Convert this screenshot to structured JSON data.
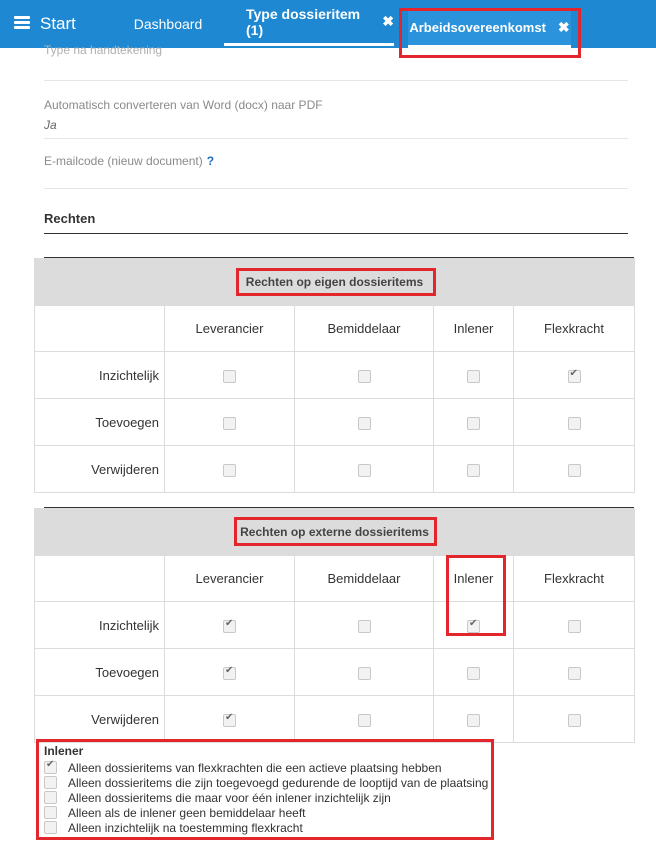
{
  "topbar": {
    "start_label": "Start",
    "tabs": [
      {
        "label": "Dashboard"
      },
      {
        "label": "Type dossieritem (1)",
        "close": "✖"
      },
      {
        "label": "Arbeidsovereenkomst",
        "close": "✖"
      }
    ]
  },
  "fields": {
    "handtekening_label": "Type na handtekening",
    "convert_label": "Automatisch converteren van Word (docx) naar PDF",
    "convert_value": "Ja",
    "email_label": "E-mailcode (nieuw document)",
    "email_help": "?"
  },
  "section": {
    "title": "Rechten"
  },
  "tables": [
    {
      "caption": "Rechten op eigen dossieritems",
      "columns": [
        "Leverancier",
        "Bemiddelaar",
        "Inlener",
        "Flexkracht"
      ],
      "rows": [
        {
          "label": "Inzichtelijk",
          "checked": [
            false,
            false,
            false,
            true
          ]
        },
        {
          "label": "Toevoegen",
          "checked": [
            false,
            false,
            false,
            false
          ]
        },
        {
          "label": "Verwijderen",
          "checked": [
            false,
            false,
            false,
            false
          ]
        }
      ]
    },
    {
      "caption": "Rechten op externe dossieritems",
      "columns": [
        "Leverancier",
        "Bemiddelaar",
        "Inlener",
        "Flexkracht"
      ],
      "rows": [
        {
          "label": "Inzichtelijk",
          "checked": [
            true,
            false,
            true,
            false
          ]
        },
        {
          "label": "Toevoegen",
          "checked": [
            true,
            false,
            false,
            false
          ]
        },
        {
          "label": "Verwijderen",
          "checked": [
            true,
            false,
            false,
            false
          ]
        }
      ]
    }
  ],
  "inlener": {
    "title": "Inlener",
    "options": [
      {
        "label": "Alleen dossieritems van flexkrachten die een actieve plaatsing hebben",
        "checked": true
      },
      {
        "label": "Alleen dossieritems die zijn toegevoegd gedurende de looptijd van de plaatsing",
        "checked": false
      },
      {
        "label": "Alleen dossieritems die maar voor één inlener inzichtelijk zijn",
        "checked": false
      },
      {
        "label": "Alleen als de inlener geen bemiddelaar heeft",
        "checked": false
      },
      {
        "label": "Alleen inzichtelijk na toestemming flexkracht",
        "checked": false
      }
    ]
  },
  "colors": {
    "topbar": "#1e88d2",
    "highlight": "#e3262c"
  }
}
